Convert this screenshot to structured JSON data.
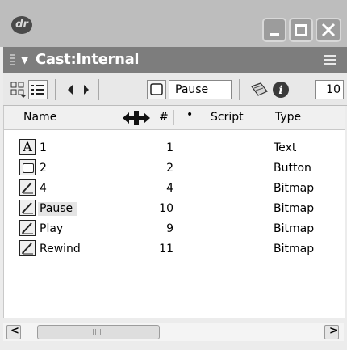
{
  "titlebar": {
    "app_icon_text": "dr"
  },
  "cast": {
    "title": "Cast:Internal"
  },
  "toolbar": {
    "member_name_value": "Pause",
    "member_number_value": "10"
  },
  "columns": {
    "name": "Name",
    "number": "#",
    "dot": "•",
    "script": "Script",
    "type": "Type"
  },
  "rows": [
    {
      "icon": "text-icon",
      "name": "1",
      "number": "1",
      "type": "Text"
    },
    {
      "icon": "button-icon",
      "name": "2",
      "number": "2",
      "type": "Button"
    },
    {
      "icon": "bitmap-icon",
      "name": "4",
      "number": "4",
      "type": "Bitmap"
    },
    {
      "icon": "bitmap-icon",
      "name": "Pause",
      "number": "10",
      "type": "Bitmap"
    },
    {
      "icon": "bitmap-icon",
      "name": "Play",
      "number": "9",
      "type": "Bitmap"
    },
    {
      "icon": "bitmap-icon",
      "name": "Rewind",
      "number": "11",
      "type": "Bitmap"
    }
  ],
  "scrollbar": {
    "left_arrow": "<",
    "right_arrow": ">"
  }
}
